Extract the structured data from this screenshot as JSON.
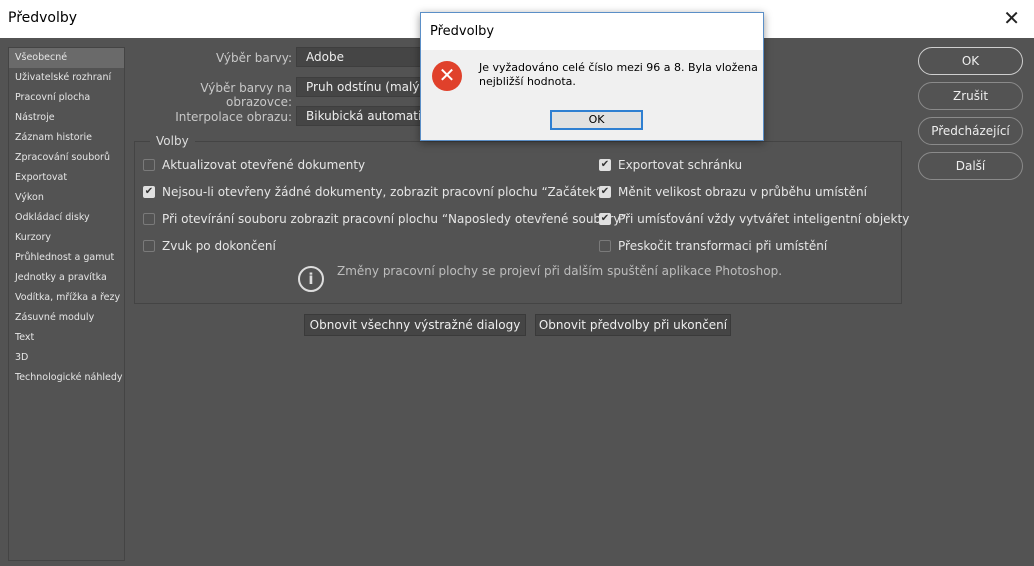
{
  "window": {
    "title": "Předvolby",
    "close_icon": "close-icon"
  },
  "sidebar": {
    "items": [
      "Všeobecné",
      "Uživatelské rozhraní",
      "Pracovní plocha",
      "Nástroje",
      "Záznam historie",
      "Zpracování souborů",
      "Exportovat",
      "Výkon",
      "Odkládací disky",
      "Kurzory",
      "Průhlednost a gamut",
      "Jednotky a pravítka",
      "Vodítka, mřížka a řezy",
      "Zásuvné moduly",
      "Text",
      "3D",
      "Technologické náhledy"
    ],
    "selected": "Všeobecné"
  },
  "fields": [
    {
      "label": "Výběr barvy:",
      "value": "Adobe"
    },
    {
      "label": "Výběr barvy na obrazovce:",
      "value": "Pruh odstínu (malý)"
    },
    {
      "label": "Interpolace obrazu:",
      "value": "Bikubická automaticky"
    }
  ],
  "options": {
    "title": "Volby",
    "left": [
      {
        "label": "Aktualizovat otevřené dokumenty",
        "checked": false
      },
      {
        "label": "Nejsou-li otevřeny žádné dokumenty, zobrazit pracovní plochu “Začátek”",
        "checked": true
      },
      {
        "label": "Při otevírání souboru zobrazit pracovní plochu “Naposledy otevřené soubory”",
        "checked": false
      },
      {
        "label": "Zvuk po dokončení",
        "checked": false
      }
    ],
    "right": [
      {
        "label": "Exportovat schránku",
        "checked": true
      },
      {
        "label": "Měnit velikost obrazu v průběhu umístění",
        "checked": true
      },
      {
        "label": "Při umísťování vždy vytvářet inteligentní objekty",
        "checked": true
      },
      {
        "label": "Přeskočit transformaci při umístění",
        "checked": false
      }
    ],
    "info": "Změny pracovní plochy se projeví při dalším spuštění aplikace Photoshop."
  },
  "buttons": {
    "reset_warnings": "Obnovit všechny výstražné dialogy",
    "reset_prefs": "Obnovit předvolby při ukončení",
    "ok": "OK",
    "cancel": "Zrušit",
    "prev": "Předcházející",
    "next": "Další"
  },
  "alert": {
    "title": "Předvolby",
    "message": "Je vyžadováno celé číslo mezi 96 a 8. Byla vložena nejbližší hodnota.",
    "ok": "OK",
    "icon": "error-icon"
  }
}
